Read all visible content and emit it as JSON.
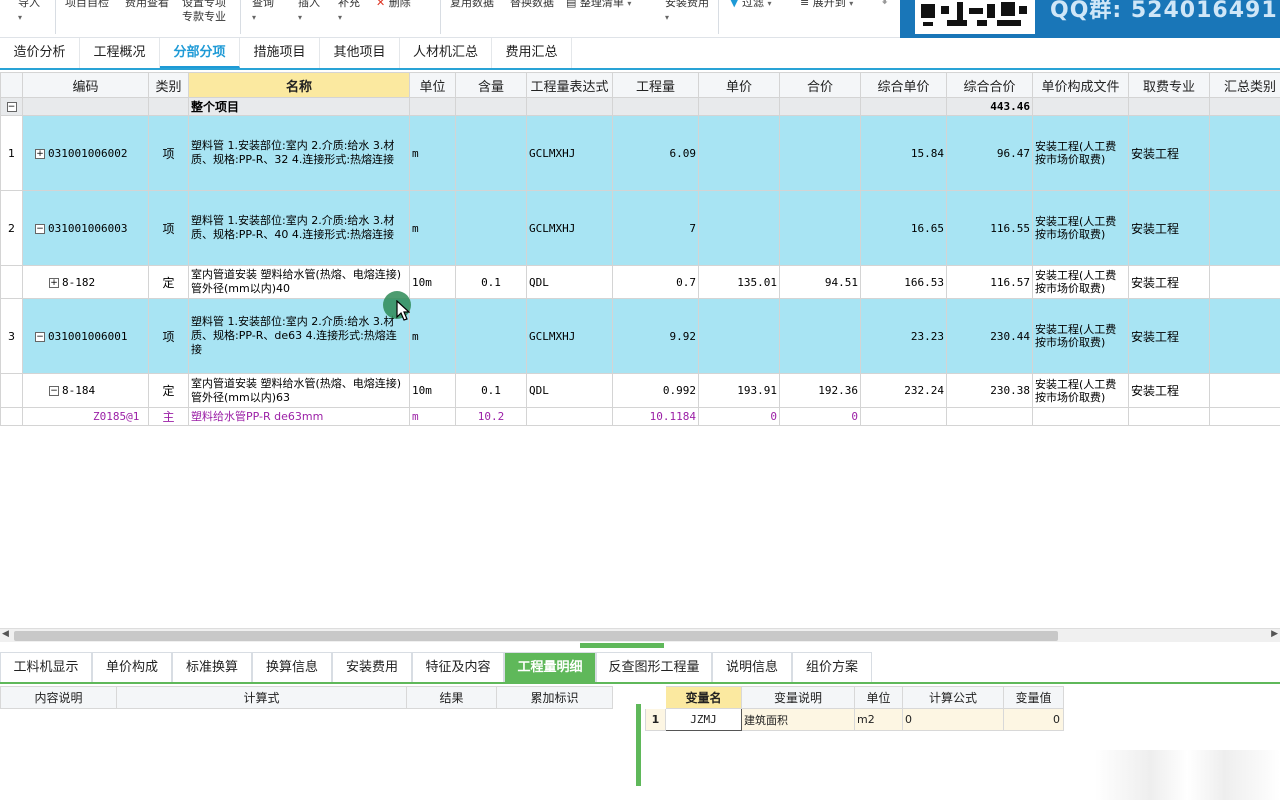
{
  "toolbar": {
    "items": [
      {
        "label": "导入",
        "sub": ""
      },
      {
        "label": "项目自检",
        "sub": ""
      },
      {
        "label": "费用查看",
        "sub": ""
      },
      {
        "label": "设置专项",
        "sub": "专款专业"
      },
      {
        "label": "查询",
        "sub": ""
      },
      {
        "label": "插入",
        "sub": ""
      },
      {
        "label": "补充",
        "sub": ""
      },
      {
        "label": "删除",
        "sub": ""
      },
      {
        "label": "复用数据",
        "sub": ""
      },
      {
        "label": "替换数据",
        "sub": ""
      },
      {
        "label": "整理清单",
        "sub": ""
      },
      {
        "label": "安装费用",
        "sub": ""
      },
      {
        "label": "过滤",
        "sub": ""
      },
      {
        "label": "展开到",
        "sub": ""
      }
    ]
  },
  "banner": {
    "text": "QQ群: 524016491"
  },
  "tabs": [
    "造价分析",
    "工程概况",
    "分部分项",
    "措施项目",
    "其他项目",
    "人材机汇总",
    "费用汇总"
  ],
  "active_tab": "分部分项",
  "grid": {
    "headers": [
      "编码",
      "类别",
      "名称",
      "单位",
      "含量",
      "工程量表达式",
      "工程量",
      "单价",
      "合价",
      "综合单价",
      "综合合价",
      "单价构成文件",
      "取费专业",
      "汇总类别"
    ],
    "total_row": {
      "name": "整个项目",
      "total": "443.46"
    },
    "rows": [
      {
        "no": "1",
        "code": "031001006002",
        "type": "项",
        "name": "塑料管\n1.安装部位:室内\n2.介质:给水\n3.材质、规格:PP-R、32\n4.连接形式:热熔连接",
        "unit": "m",
        "content": "",
        "expr": "GCLMXHJ",
        "qty": "6.09",
        "price": "",
        "amount": "",
        "unit_comp": "15.84",
        "total_comp": "96.47",
        "file": "安装工程(人工费按市场价取费)",
        "spec": "安装工程",
        "exp": "+"
      },
      {
        "no": "2",
        "code": "031001006003",
        "type": "项",
        "name": "塑料管\n1.安装部位:室内\n2.介质:给水\n3.材质、规格:PP-R、40\n4.连接形式:热熔连接",
        "unit": "m",
        "content": "",
        "expr": "GCLMXHJ",
        "qty": "7",
        "price": "",
        "amount": "",
        "unit_comp": "16.65",
        "total_comp": "116.55",
        "file": "安装工程(人工费按市场价取费)",
        "spec": "安装工程",
        "exp": "−"
      },
      {
        "no": "",
        "code": "8-182",
        "type": "定",
        "name": "室内管道安装 塑料给水管(热熔、电熔连接) 管外径(mm以内)40",
        "unit": "10m",
        "content": "0.1",
        "expr": "QDL",
        "qty": "0.7",
        "price": "135.01",
        "amount": "94.51",
        "unit_comp": "166.53",
        "total_comp": "116.57",
        "file": "安装工程(人工费按市场价取费)",
        "spec": "安装工程",
        "exp": "+"
      },
      {
        "no": "3",
        "code": "031001006001",
        "type": "项",
        "name": "塑料管\n1.安装部位:室内\n2.介质:给水\n3.材质、规格:PP-R、de63\n4.连接形式:热熔连接",
        "unit": "m",
        "content": "",
        "expr": "GCLMXHJ",
        "qty": "9.92",
        "price": "",
        "amount": "",
        "unit_comp": "23.23",
        "total_comp": "230.44",
        "file": "安装工程(人工费按市场价取费)",
        "spec": "安装工程",
        "exp": "−"
      },
      {
        "no": "",
        "code": "8-184",
        "type": "定",
        "name": "室内管道安装 塑料给水管(热熔、电熔连接) 管外径(mm以内)63",
        "unit": "10m",
        "content": "0.1",
        "expr": "QDL",
        "qty": "0.992",
        "price": "193.91",
        "amount": "192.36",
        "unit_comp": "232.24",
        "total_comp": "230.38",
        "file": "安装工程(人工费按市场价取费)",
        "spec": "安装工程",
        "exp": "−"
      },
      {
        "no": "",
        "code": "Z0185@1",
        "type": "主",
        "name": "塑料给水管PP-R de63mm",
        "unit": "m",
        "content": "10.2",
        "expr": "",
        "qty": "10.1184",
        "price": "0",
        "amount": "0",
        "unit_comp": "",
        "total_comp": "",
        "file": "",
        "spec": "",
        "exp": ""
      }
    ]
  },
  "bottom_tabs": [
    "工料机显示",
    "单价构成",
    "标准换算",
    "换算信息",
    "安装费用",
    "特征及内容",
    "工程量明细",
    "反查图形工程量",
    "说明信息",
    "组价方案"
  ],
  "active_bottom_tab": "工程量明细",
  "detail_headers": [
    "内容说明",
    "计算式",
    "结果",
    "累加标识"
  ],
  "var_table": {
    "headers": [
      "变量名",
      "变量说明",
      "单位",
      "计算公式",
      "变量值"
    ],
    "rows": [
      {
        "no": "1",
        "name": "JZMJ",
        "desc": "建筑面积",
        "unit": "m2",
        "formula": "0",
        "value": "0"
      }
    ]
  },
  "colors": {
    "accent": "#1e9ad6",
    "row_highlight": "#a8e4f3",
    "green": "#5fb85a",
    "header_yellow": "#fbe9a0",
    "main_material": "#9b1fa6"
  }
}
